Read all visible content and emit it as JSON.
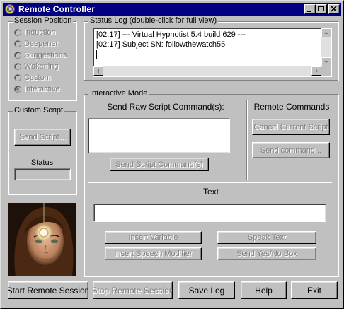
{
  "window": {
    "title": "Remote Controller",
    "title_icon": "spiral-icon",
    "controls": [
      "minimize-icon",
      "maximize-icon",
      "close-icon"
    ]
  },
  "session_position": {
    "legend": "Session Position",
    "items": [
      {
        "label": "Induction",
        "checked": false
      },
      {
        "label": "Deepener",
        "checked": false
      },
      {
        "label": "Suggestions",
        "checked": false
      },
      {
        "label": "Wakening",
        "checked": false
      },
      {
        "label": "Custom",
        "checked": false
      },
      {
        "label": "Interactive",
        "checked": true
      }
    ]
  },
  "status_log": {
    "legend": "Status Log (double-click for full view)",
    "lines": [
      "[02:17] --- Virtual Hypnotist 5.4 build 629 ---",
      "[02:17] Subject SN: followthewatch55"
    ]
  },
  "custom_script": {
    "legend": "Custom Script",
    "send_script_label": "Send Script...",
    "status_label": "Status",
    "status_value": ""
  },
  "interactive_mode": {
    "legend": "Interactive Mode",
    "raw_heading": "Send Raw Script Command(s):",
    "raw_value": "",
    "send_script_command_label": "Send Script Command(s)",
    "remote_heading": "Remote Commands",
    "cancel_script_label": "Cancel Current Script",
    "send_command_label": "Send command...",
    "text_heading": "Text",
    "text_value": "",
    "insert_variable_label": "Insert Variable",
    "speak_text_label": "Speak Text",
    "insert_speech_modifier_label": "Insert Speech Modifier",
    "send_yes_no_label": "Send Yes/No Box"
  },
  "bottom_buttons": {
    "start_label": "Start Remote Session",
    "stop_label": "Stop Remote Session",
    "save_log_label": "Save Log",
    "help_label": "Help",
    "exit_label": "Exit"
  }
}
